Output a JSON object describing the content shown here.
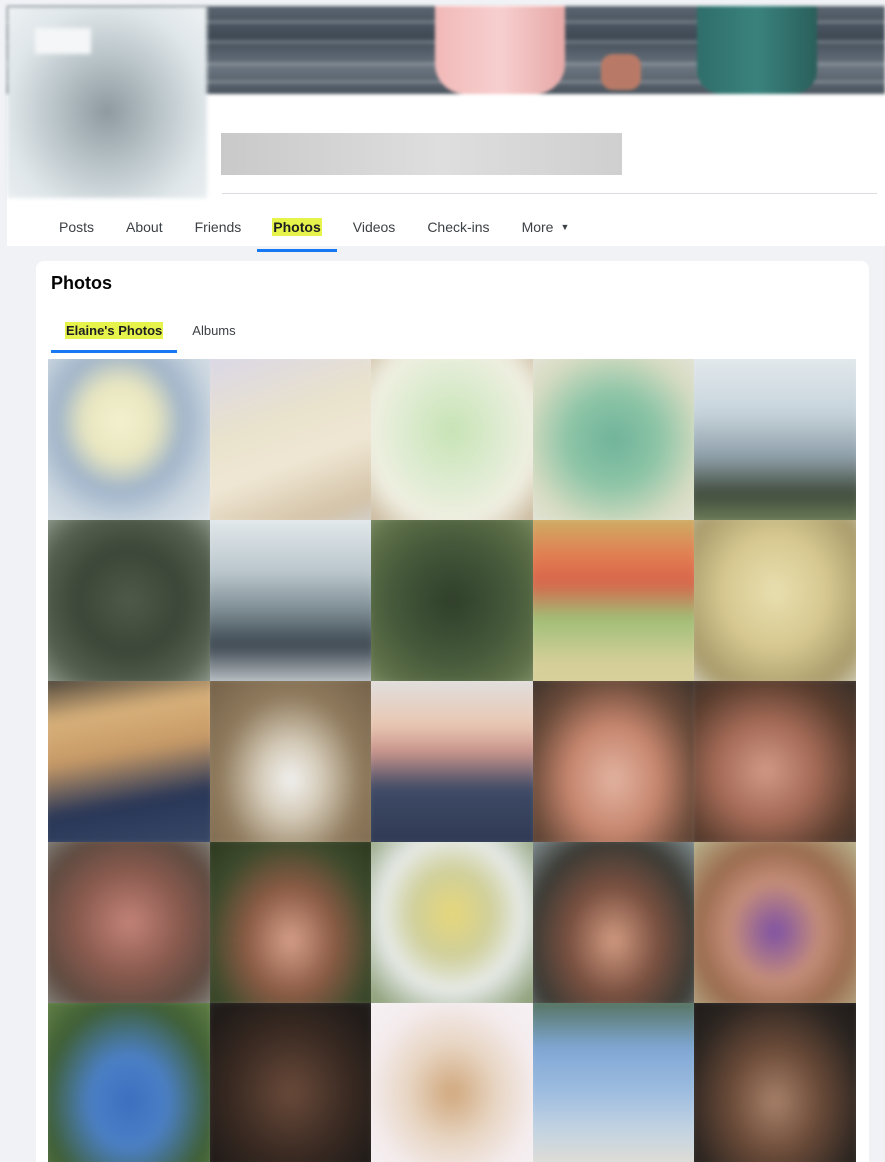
{
  "profile_tabs": [
    {
      "label": "Posts",
      "active": false
    },
    {
      "label": "About",
      "active": false
    },
    {
      "label": "Friends",
      "active": false
    },
    {
      "label": "Photos",
      "active": true
    },
    {
      "label": "Videos",
      "active": false
    },
    {
      "label": "Check-ins",
      "active": false
    },
    {
      "label": "More",
      "active": false,
      "dropdown": true
    }
  ],
  "photos_section": {
    "title": "Photos",
    "tabs": [
      {
        "label": "Elaine's Photos",
        "active": true
      },
      {
        "label": "Albums",
        "active": false
      }
    ]
  },
  "colors": {
    "accent": "#1877f2",
    "highlight": "#e6f34a",
    "page_background": "#f0f2f5"
  },
  "photos": [
    {
      "bg": "radial-gradient(ellipse at 45% 40%, #f4f1cf 0%, #e8e6c0 25%, #9fb3c9 45%, #c8d4de 65%, #e9ecee 100%)"
    },
    {
      "bg": "linear-gradient(160deg, #d9d6ea 0%, #e9e2cc 40%, #efe7d4 60%, #d4c3a7 85%, #cfd3d7 100%)"
    },
    {
      "bg": "radial-gradient(ellipse at 50% 45%, #c7e3b4 0%, #dcebcf 35%, #f0efe2 65%, #c8b69a 90%)"
    },
    {
      "bg": "radial-gradient(ellipse at 50% 50%, #6fb39a 0%, #8cc4a6 35%, #d7dcc2 70%, #e8e6df 100%)"
    },
    {
      "bg": "linear-gradient(180deg, #e7ecef 0%, #c7d4dc 35%, #8e9ea8 60%, #3f4b3c 80%, #7a8a60 100%)"
    },
    {
      "bg": "radial-gradient(ellipse at 50% 50%, #4f5a4a 0%, #3b4638 40%, #556050 70%, #a4aca0 100%)"
    },
    {
      "bg": "linear-gradient(180deg, #e9eef1 0%, #b9c6cc 35%, #7e8e94 55%, #3c4650 75%, #d7dde0 100%)"
    },
    {
      "bg": "radial-gradient(ellipse at 50% 50%, #2f3f2a 0%, #44583a 45%, #5e7048 75%, #8a9a74 100%)"
    },
    {
      "bg": "linear-gradient(180deg, #c9b96b 0%, #e27e52 25%, #d8644a 40%, #9fbf77 60%, #d7cf9a 85%)"
    },
    {
      "bg": "radial-gradient(ellipse at 50% 45%, #e9dfb0 0%, #d6c88f 40%, #a89a6a 75%, #e4e3d8 100%)"
    },
    {
      "bg": "linear-gradient(170deg, #2d2d2d 0%, #d7b07a 25%, #c89a66 45%, #283657 70%, #3c4a6a 100%)"
    },
    {
      "bg": "radial-gradient(ellipse at 50% 60%, #f3f3f3 0%, #d3c9b6 25%, #8f7a5c 55%, #6d5b44 100%)"
    },
    {
      "bg": "linear-gradient(180deg, #dfe3e6 0%, #e9c7b2 30%, #c7928a 45%, #3e4a66 65%, #2d3650 100%)"
    },
    {
      "bg": "radial-gradient(ellipse at 50% 60%, #e2b4a2 0%, #c7866e 35%, #6b4b3a 65%, #2e2a26 100%)"
    },
    {
      "bg": "radial-gradient(ellipse at 45% 55%, #d29a88 0%, #a46a56 35%, #5a3d2e 65%, #2c2a28 100%)"
    },
    {
      "bg": "radial-gradient(ellipse at 50% 50%, #c5847a 0%, #8a5a4e 40%, #5e4a40 70%, #8e9590 100%)"
    },
    {
      "bg": "radial-gradient(ellipse at 50% 60%, #d7a08a 0%, #8a5a44 35%, #3d4a2c 65%, #263219 100%)"
    },
    {
      "bg": "radial-gradient(ellipse at 50% 45%, #e7d77a 0%, #cfcf9a 30%, #e7ebe9 55%, #8ea07a 85%)"
    },
    {
      "bg": "radial-gradient(ellipse at 50% 60%, #d49c82 0%, #7a5040 35%, #3a3a34 65%, #99aab0 100%)"
    },
    {
      "bg": "radial-gradient(ellipse at 50% 55%, #7c4fa6 0%, #c58e79 35%, #9a6b4e 60%, #c3c9a0 100%)"
    },
    {
      "bg": "radial-gradient(ellipse at 50% 60%, #3b6fbf 0%, #4b80c6 30%, #3f5e34 65%, #6b8a4a 100%)"
    },
    {
      "bg": "radial-gradient(ellipse at 50% 55%, #6a4a3a 0%, #3a2a22 45%, #1e1a18 80%, #2a2624 100%)"
    },
    {
      "bg": "radial-gradient(ellipse at 50% 55%, #cfa67a 0%, #e8d6c4 35%, #f4ecee 65%, #f7f3f5 100%)"
    },
    {
      "bg": "linear-gradient(180deg, #4e6a4a 0%, #7fa7d4 30%, #9ebde0 55%, #c2d3e2 75%, #e7dfd3 100%)"
    },
    {
      "bg": "radial-gradient(ellipse at 50% 60%, #a9826a 0%, #6a4a38 35%, #2a2420 70%, #1a1716 100%)"
    }
  ]
}
